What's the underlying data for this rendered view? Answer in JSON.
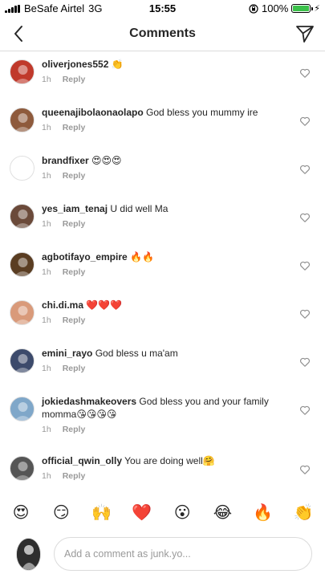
{
  "status": {
    "carrier": "BeSafe Airtel",
    "network": "3G",
    "time": "15:55",
    "battery": "100%",
    "battery_level": 1.0
  },
  "header": {
    "title": "Comments"
  },
  "comments": [
    {
      "username": "oliverjones552",
      "text": "👏",
      "time": "1h",
      "reply": "Reply",
      "avatar_color": "#c0392b"
    },
    {
      "username": "queenajibolaonaolapo",
      "text": "God bless you mummy ire",
      "time": "1h",
      "reply": "Reply",
      "avatar_color": "#8e5a3c"
    },
    {
      "username": "brandfixer",
      "text": "😍😍😍",
      "time": "1h",
      "reply": "Reply",
      "avatar_color": "#ffffff"
    },
    {
      "username": "yes_iam_tenaj",
      "text": "U did well Ma",
      "time": "1h",
      "reply": "Reply",
      "avatar_color": "#6b4a3a"
    },
    {
      "username": "agbotifayo_empire",
      "text": "🔥🔥",
      "time": "1h",
      "reply": "Reply",
      "avatar_color": "#5a3d22"
    },
    {
      "username": "chi.di.ma",
      "text": "❤️❤️❤️",
      "time": "1h",
      "reply": "Reply",
      "avatar_color": "#d99a7a"
    },
    {
      "username": "emini_rayo",
      "text": "God bless u ma'am",
      "time": "1h",
      "reply": "Reply",
      "avatar_color": "#3c4a6b"
    },
    {
      "username": "jokiedashmakeovers",
      "text": "God bless you  and your family momma😘😘😘😘",
      "time": "1h",
      "reply": "Reply",
      "avatar_color": "#7fa7c9"
    },
    {
      "username": "official_qwin_olly",
      "text": "You are doing well🤗",
      "time": "1h",
      "reply": "Reply",
      "avatar_color": "#555555"
    }
  ],
  "emoji_bar": [
    "😍",
    "😏",
    "🙌",
    "❤️",
    "😮",
    "😂",
    "🔥",
    "👏"
  ],
  "composer": {
    "placeholder": "Add a comment as junk.yo..."
  },
  "colors": {
    "text": "#262626",
    "meta": "#999999",
    "divider": "#dbdbdb",
    "battery_green": "#3bc14a"
  }
}
